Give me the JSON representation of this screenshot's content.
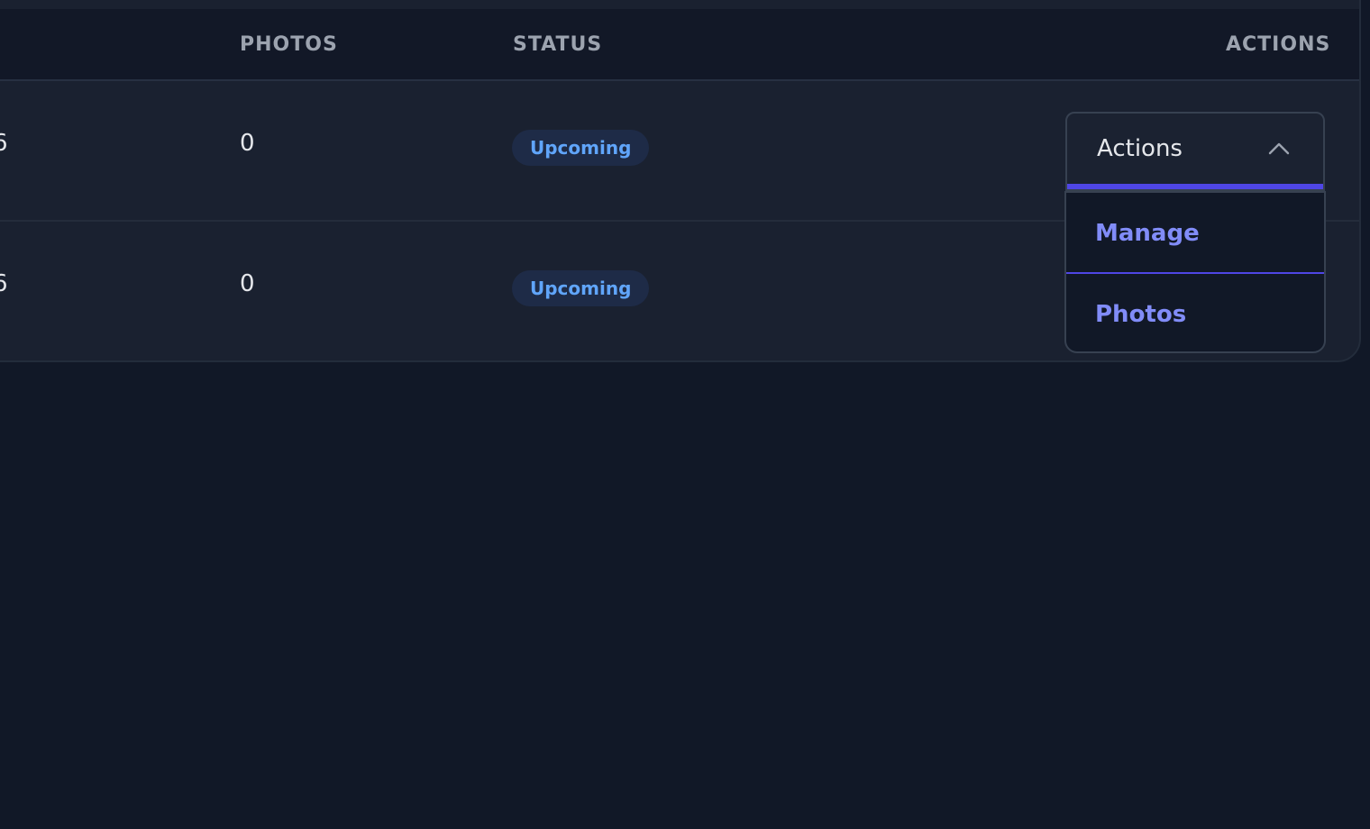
{
  "table": {
    "columns": {
      "photos": "PHOTOS",
      "status": "STATUS",
      "actions": "ACTIONS"
    },
    "rows": [
      {
        "partial_value": "6",
        "photos": "0",
        "status": "Upcoming"
      },
      {
        "partial_value": "6",
        "photos": "0",
        "status": "Upcoming"
      }
    ]
  },
  "actions_dropdown": {
    "label": "Actions",
    "state": "open",
    "icon": "chevron-up-icon",
    "items": [
      "Manage",
      "Photos"
    ]
  },
  "colors": {
    "background": "#111827",
    "table_body": "#1a2130",
    "header_row": "#121827",
    "status_badge_bg": "#1e2b47",
    "status_badge_text": "#60a5fa",
    "menu_item_text": "#818cf8",
    "accent": "#4f46e5"
  }
}
